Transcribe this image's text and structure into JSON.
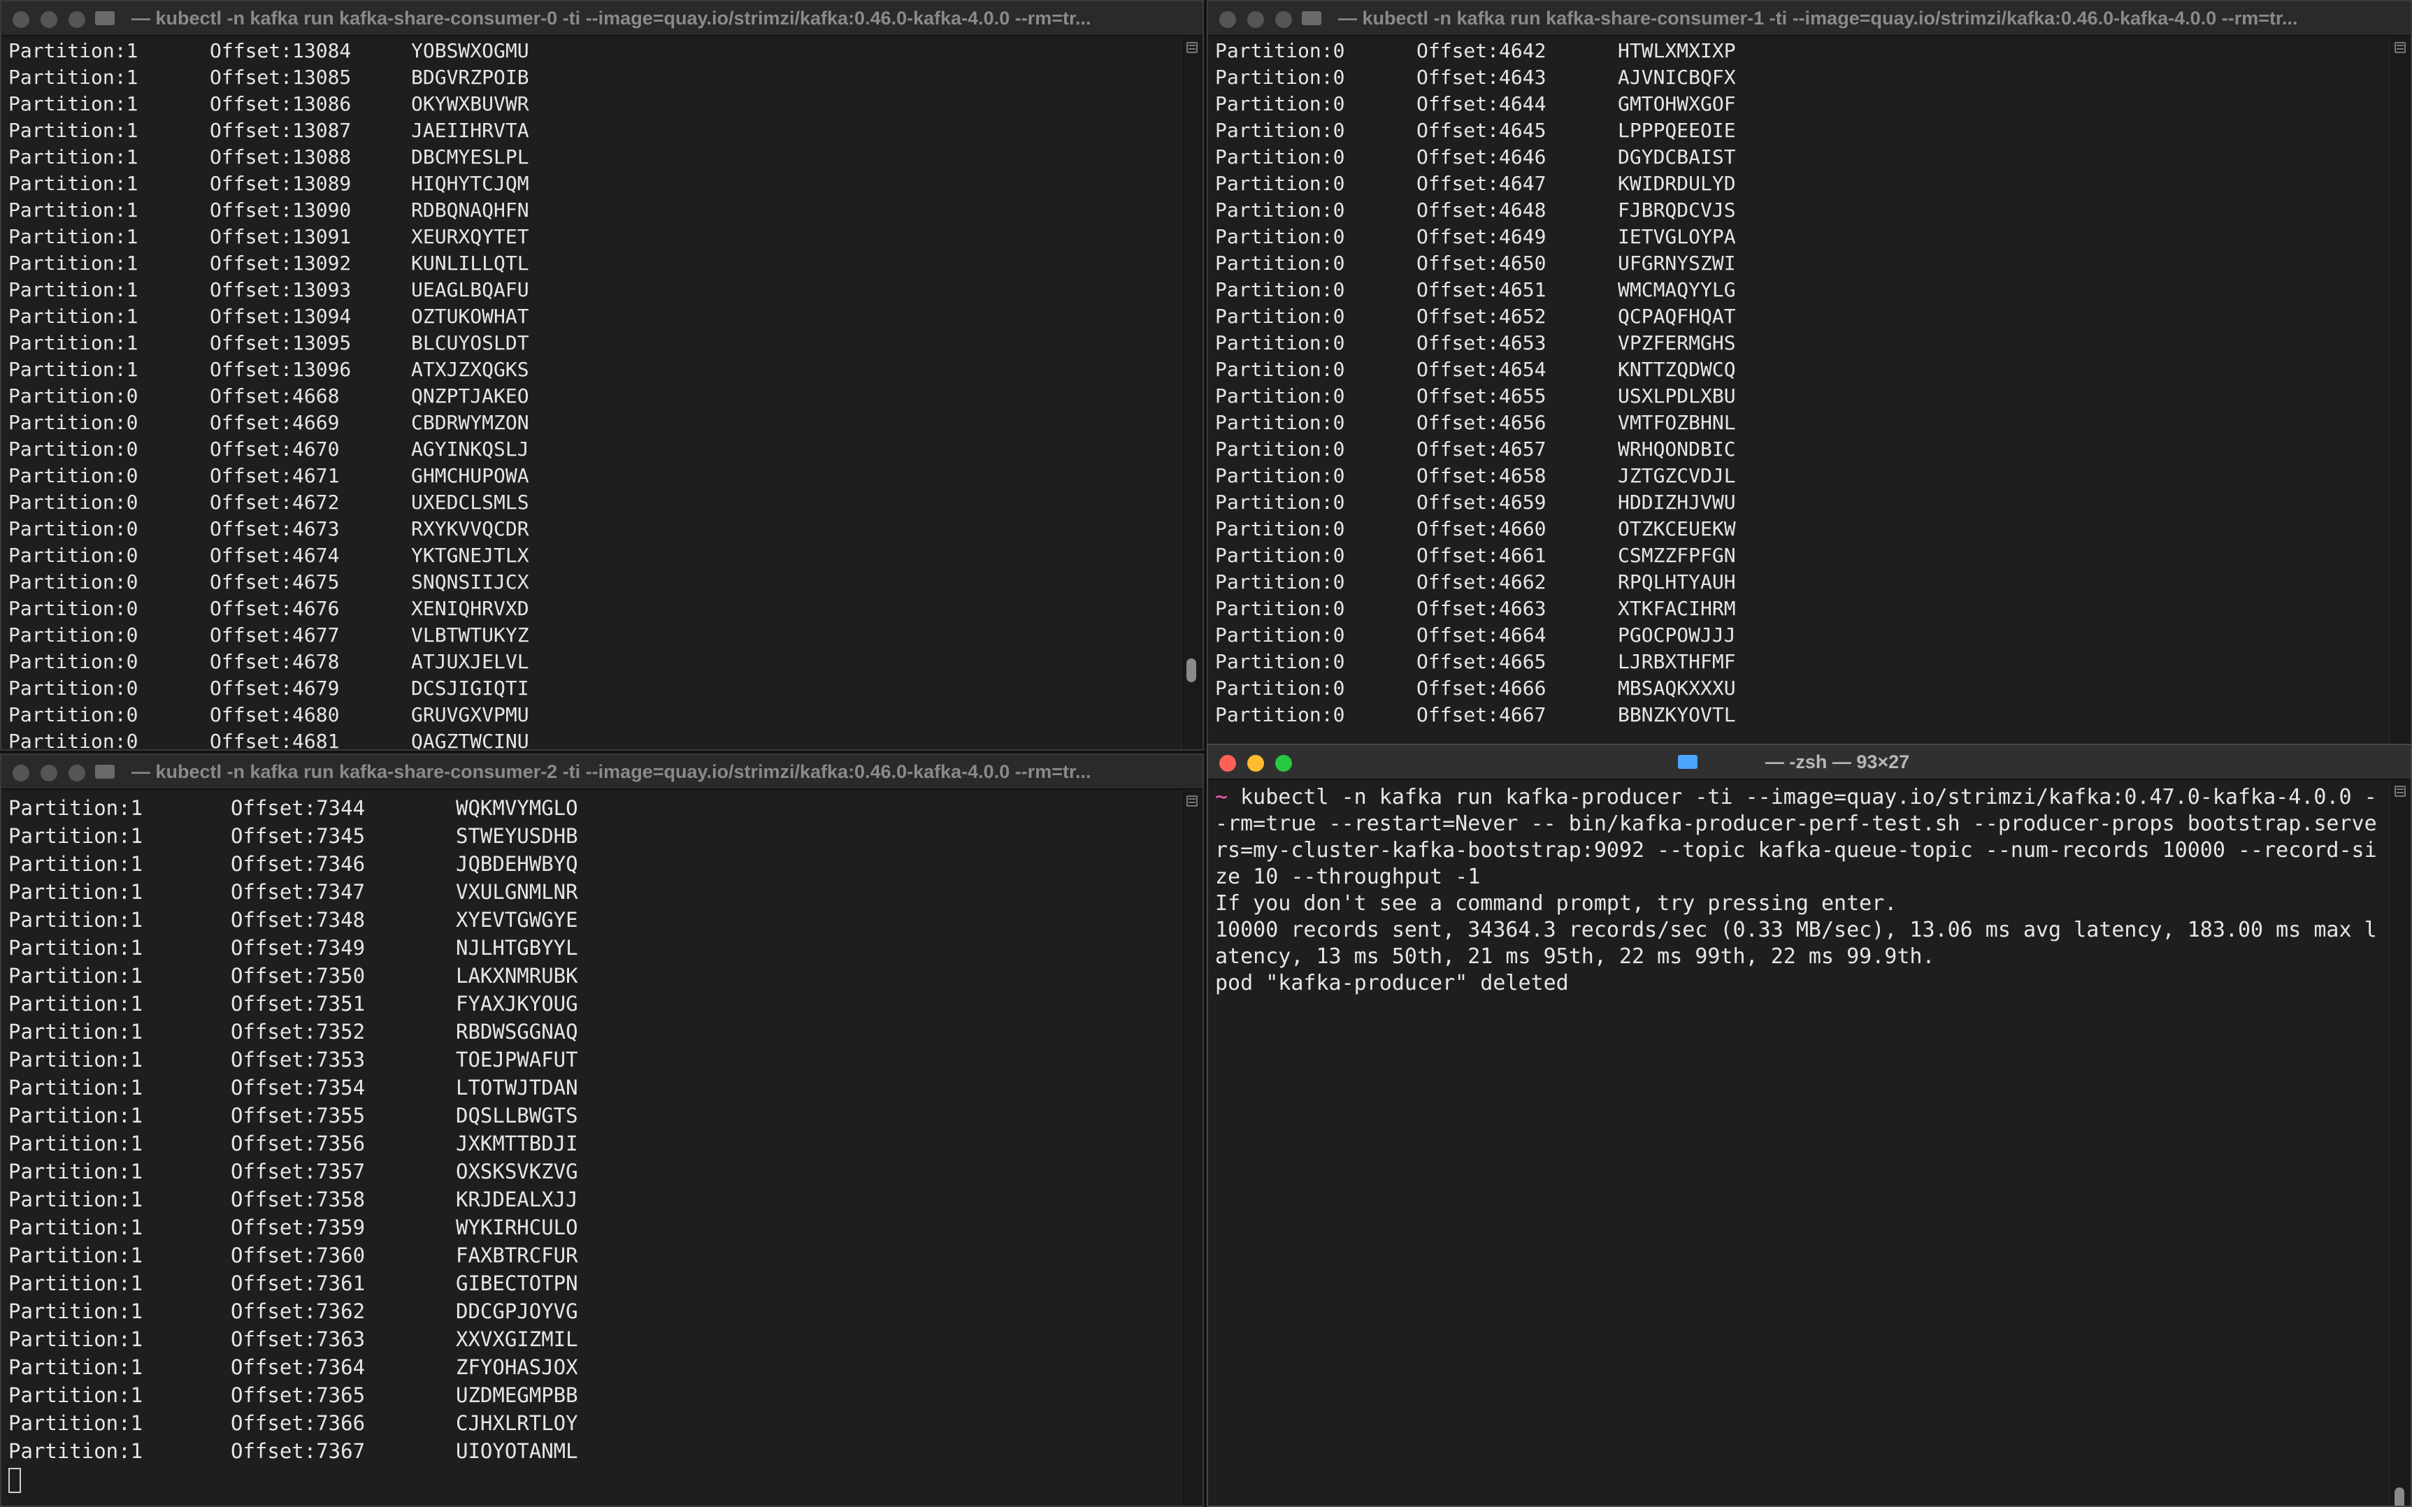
{
  "windows": {
    "consumer0": {
      "title": "— kubectl -n kafka run kafka-share-consumer-0 -ti --image=quay.io/strimzi/kafka:0.46.0-kafka-4.0.0 --rm=tr...",
      "rows": [
        [
          "Partition:1",
          "Offset:13084",
          "YOBSWXOGMU"
        ],
        [
          "Partition:1",
          "Offset:13085",
          "BDGVRZPOIB"
        ],
        [
          "Partition:1",
          "Offset:13086",
          "OKYWXBUVWR"
        ],
        [
          "Partition:1",
          "Offset:13087",
          "JAEIIHRVTA"
        ],
        [
          "Partition:1",
          "Offset:13088",
          "DBCMYESLPL"
        ],
        [
          "Partition:1",
          "Offset:13089",
          "HIQHYTCJQM"
        ],
        [
          "Partition:1",
          "Offset:13090",
          "RDBQNAQHFN"
        ],
        [
          "Partition:1",
          "Offset:13091",
          "XEURXQYTET"
        ],
        [
          "Partition:1",
          "Offset:13092",
          "KUNLILLQTL"
        ],
        [
          "Partition:1",
          "Offset:13093",
          "UEAGLBQAFU"
        ],
        [
          "Partition:1",
          "Offset:13094",
          "OZTUKOWHAT"
        ],
        [
          "Partition:1",
          "Offset:13095",
          "BLCUYOSLDT"
        ],
        [
          "Partition:1",
          "Offset:13096",
          "ATXJZXQGKS"
        ],
        [
          "Partition:0",
          "Offset:4668",
          "QNZPTJAKEO"
        ],
        [
          "Partition:0",
          "Offset:4669",
          "CBDRWYMZON"
        ],
        [
          "Partition:0",
          "Offset:4670",
          "AGYINKQSLJ"
        ],
        [
          "Partition:0",
          "Offset:4671",
          "GHMCHUPOWA"
        ],
        [
          "Partition:0",
          "Offset:4672",
          "UXEDCLSMLS"
        ],
        [
          "Partition:0",
          "Offset:4673",
          "RXYKVVQCDR"
        ],
        [
          "Partition:0",
          "Offset:4674",
          "YKTGNEJTLX"
        ],
        [
          "Partition:0",
          "Offset:4675",
          "SNQNSIIJCX"
        ],
        [
          "Partition:0",
          "Offset:4676",
          "XENIQHRVXD"
        ],
        [
          "Partition:0",
          "Offset:4677",
          "VLBTWTUKYZ"
        ],
        [
          "Partition:0",
          "Offset:4678",
          "ATJUXJELVL"
        ],
        [
          "Partition:0",
          "Offset:4679",
          "DCSJIGIQTI"
        ],
        [
          "Partition:0",
          "Offset:4680",
          "GRUVGXVPMU"
        ],
        [
          "Partition:0",
          "Offset:4681",
          "QAGZTWCINU"
        ]
      ]
    },
    "consumer1": {
      "title": "— kubectl -n kafka run kafka-share-consumer-1 -ti --image=quay.io/strimzi/kafka:0.46.0-kafka-4.0.0 --rm=tr...",
      "rows": [
        [
          "Partition:0",
          "Offset:4642",
          "HTWLXMXIXP"
        ],
        [
          "Partition:0",
          "Offset:4643",
          "AJVNICBQFX"
        ],
        [
          "Partition:0",
          "Offset:4644",
          "GMTOHWXGOF"
        ],
        [
          "Partition:0",
          "Offset:4645",
          "LPPPQEEOIE"
        ],
        [
          "Partition:0",
          "Offset:4646",
          "DGYDCBAIST"
        ],
        [
          "Partition:0",
          "Offset:4647",
          "KWIDRDULYD"
        ],
        [
          "Partition:0",
          "Offset:4648",
          "FJBRQDCVJS"
        ],
        [
          "Partition:0",
          "Offset:4649",
          "IETVGLOYPA"
        ],
        [
          "Partition:0",
          "Offset:4650",
          "UFGRNYSZWI"
        ],
        [
          "Partition:0",
          "Offset:4651",
          "WMCMAQYYLG"
        ],
        [
          "Partition:0",
          "Offset:4652",
          "QCPAQFHQAT"
        ],
        [
          "Partition:0",
          "Offset:4653",
          "VPZFERMGHS"
        ],
        [
          "Partition:0",
          "Offset:4654",
          "KNTTZQDWCQ"
        ],
        [
          "Partition:0",
          "Offset:4655",
          "USXLPDLXBU"
        ],
        [
          "Partition:0",
          "Offset:4656",
          "VMTFOZBHNL"
        ],
        [
          "Partition:0",
          "Offset:4657",
          "WRHQONDBIC"
        ],
        [
          "Partition:0",
          "Offset:4658",
          "JZTGZCVDJL"
        ],
        [
          "Partition:0",
          "Offset:4659",
          "HDDIZHJVWU"
        ],
        [
          "Partition:0",
          "Offset:4660",
          "OTZKCEUEKW"
        ],
        [
          "Partition:0",
          "Offset:4661",
          "CSMZZFPFGN"
        ],
        [
          "Partition:0",
          "Offset:4662",
          "RPQLHTYAUH"
        ],
        [
          "Partition:0",
          "Offset:4663",
          "XTKFACIHRM"
        ],
        [
          "Partition:0",
          "Offset:4664",
          "PGOCPOWJJJ"
        ],
        [
          "Partition:0",
          "Offset:4665",
          "LJRBXTHFMF"
        ],
        [
          "Partition:0",
          "Offset:4666",
          "MBSAQKXXXU"
        ],
        [
          "Partition:0",
          "Offset:4667",
          "BBNZKYOVTL"
        ]
      ]
    },
    "consumer2": {
      "title": "— kubectl -n kafka run kafka-share-consumer-2 -ti --image=quay.io/strimzi/kafka:0.46.0-kafka-4.0.0 --rm=tr...",
      "rows": [
        [
          "Partition:1",
          "Offset:7344",
          "WQKMVYMGLO"
        ],
        [
          "Partition:1",
          "Offset:7345",
          "STWEYUSDHB"
        ],
        [
          "Partition:1",
          "Offset:7346",
          "JQBDEHWBYQ"
        ],
        [
          "Partition:1",
          "Offset:7347",
          "VXULGNMLNR"
        ],
        [
          "Partition:1",
          "Offset:7348",
          "XYEVTGWGYE"
        ],
        [
          "Partition:1",
          "Offset:7349",
          "NJLHTGBYYL"
        ],
        [
          "Partition:1",
          "Offset:7350",
          "LAKXNMRUBK"
        ],
        [
          "Partition:1",
          "Offset:7351",
          "FYAXJKYOUG"
        ],
        [
          "Partition:1",
          "Offset:7352",
          "RBDWSGGNAQ"
        ],
        [
          "Partition:1",
          "Offset:7353",
          "TOEJPWAFUT"
        ],
        [
          "Partition:1",
          "Offset:7354",
          "LTOTWJTDAN"
        ],
        [
          "Partition:1",
          "Offset:7355",
          "DQSLLBWGTS"
        ],
        [
          "Partition:1",
          "Offset:7356",
          "JXKMTTBDJI"
        ],
        [
          "Partition:1",
          "Offset:7357",
          "OXSKSVKZVG"
        ],
        [
          "Partition:1",
          "Offset:7358",
          "KRJDEALXJJ"
        ],
        [
          "Partition:1",
          "Offset:7359",
          "WYKIRHCULO"
        ],
        [
          "Partition:1",
          "Offset:7360",
          "FAXBTRCFUR"
        ],
        [
          "Partition:1",
          "Offset:7361",
          "GIBECTOTPN"
        ],
        [
          "Partition:1",
          "Offset:7362",
          "DDCGPJOYVG"
        ],
        [
          "Partition:1",
          "Offset:7363",
          "XXVXGIZMIL"
        ],
        [
          "Partition:1",
          "Offset:7364",
          "ZFYOHASJOX"
        ],
        [
          "Partition:1",
          "Offset:7365",
          "UZDMEGMPBB"
        ],
        [
          "Partition:1",
          "Offset:7366",
          "CJHXLRTLOY"
        ],
        [
          "Partition:1",
          "Offset:7367",
          "UIOYOTANML"
        ]
      ]
    },
    "producer": {
      "title": "— -zsh — 93×27",
      "prompt_symbol": "~",
      "command": " kubectl -n kafka run kafka-producer -ti --image=quay.io/strimzi/kafka:0.47.0-kafka-4.0.0 --rm=true --restart=Never -- bin/kafka-producer-perf-test.sh --producer-props bootstrap.servers=my-cluster-kafka-bootstrap:9092 --topic kafka-queue-topic --num-records 10000 --record-size 10 --throughput -1",
      "output": [
        "If you don't see a command prompt, try pressing enter.",
        "10000 records sent, 34364.3 records/sec (0.33 MB/sec), 13.06 ms avg latency, 183.00 ms max latency, 13 ms 50th, 21 ms 95th, 22 ms 99th, 22 ms 99.9th.",
        "pod \"kafka-producer\" deleted"
      ]
    }
  },
  "colors": {
    "red_light": "#ff5f57",
    "yellow_light": "#febc2e",
    "green_light": "#28c840",
    "prompt": "#ff5fbf",
    "folder_icon": "#4aa6ff"
  }
}
